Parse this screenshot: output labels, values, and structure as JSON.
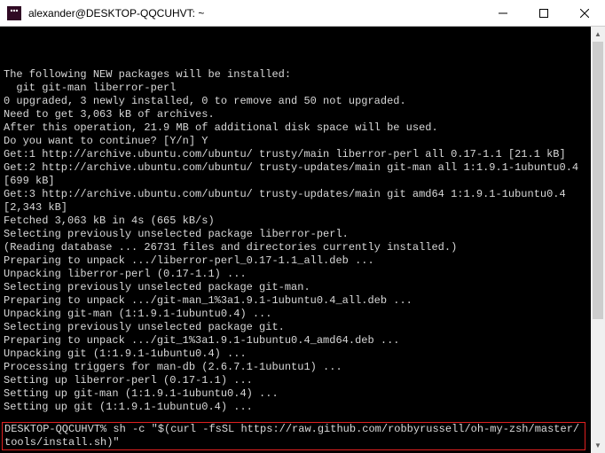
{
  "titlebar": {
    "title": "alexander@DESKTOP-QQCUHVT: ~"
  },
  "terminal": {
    "lines": [
      "The following NEW packages will be installed:",
      "  git git-man liberror-perl",
      "0 upgraded, 3 newly installed, 0 to remove and 50 not upgraded.",
      "Need to get 3,063 kB of archives.",
      "After this operation, 21.9 MB of additional disk space will be used.",
      "Do you want to continue? [Y/n] Y",
      "Get:1 http://archive.ubuntu.com/ubuntu/ trusty/main liberror-perl all 0.17-1.1 [21.1 kB]",
      "Get:2 http://archive.ubuntu.com/ubuntu/ trusty-updates/main git-man all 1:1.9.1-1ubuntu0.4 [699 kB]",
      "Get:3 http://archive.ubuntu.com/ubuntu/ trusty-updates/main git amd64 1:1.9.1-1ubuntu0.4 [2,343 kB]",
      "Fetched 3,063 kB in 4s (665 kB/s)",
      "Selecting previously unselected package liberror-perl.",
      "(Reading database ... 26731 files and directories currently installed.)",
      "Preparing to unpack .../liberror-perl_0.17-1.1_all.deb ...",
      "Unpacking liberror-perl (0.17-1.1) ...",
      "Selecting previously unselected package git-man.",
      "Preparing to unpack .../git-man_1%3a1.9.1-1ubuntu0.4_all.deb ...",
      "Unpacking git-man (1:1.9.1-1ubuntu0.4) ...",
      "Selecting previously unselected package git.",
      "Preparing to unpack .../git_1%3a1.9.1-1ubuntu0.4_amd64.deb ...",
      "Unpacking git (1:1.9.1-1ubuntu0.4) ...",
      "Processing triggers for man-db (2.6.7.1-1ubuntu1) ...",
      "Setting up liberror-perl (0.17-1.1) ...",
      "Setting up git-man (1:1.9.1-1ubuntu0.4) ...",
      "Setting up git (1:1.9.1-1ubuntu0.4) ..."
    ],
    "highlighted": "DESKTOP-QQCUHVT% sh -c \"$(curl -fsSL https://raw.github.com/robbyrussell/oh-my-zsh/master/tools/install.sh)\""
  }
}
